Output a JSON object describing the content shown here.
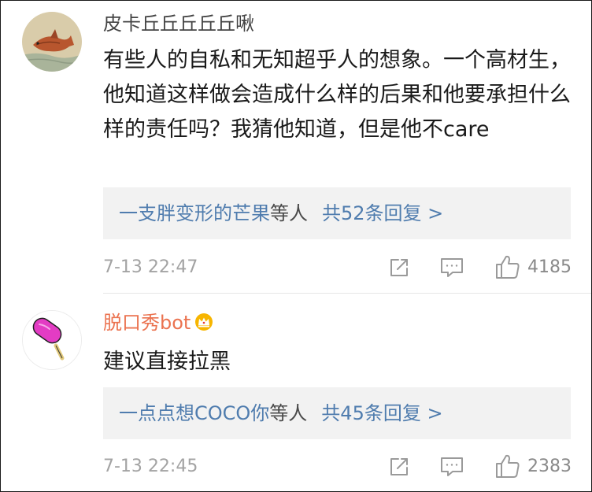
{
  "comments": [
    {
      "username": "皮卡丘丘丘丘丘啾",
      "avatar_icon": "fish-painting-avatar",
      "text": "有些人的自私和无知超乎人的想象。一个高材生，他知道这样做会造成什么样的后果和他要承担什么样的责任吗？我猜他知道，但是他不care",
      "replies": {
        "user": "一支胖变形的芒果",
        "suffix": "等人",
        "count_text": "共52条回复 >"
      },
      "time": "7-13 22:47",
      "likes": "4185"
    },
    {
      "username": "脱口秀bot",
      "badge_icon": "crown-badge-icon",
      "avatar_icon": "popsicle-avatar",
      "text": "建议直接拉黑",
      "replies": {
        "user": "一点点想COCO你",
        "suffix": "等人",
        "count_text": "共45条回复 >"
      },
      "time": "7-13 22:45",
      "likes": "2383"
    }
  ],
  "colors": {
    "link": "#4f7cae",
    "vip_name": "#eb7350",
    "meta": "#a3a3a3",
    "reply_bg": "#f2f2f2"
  }
}
